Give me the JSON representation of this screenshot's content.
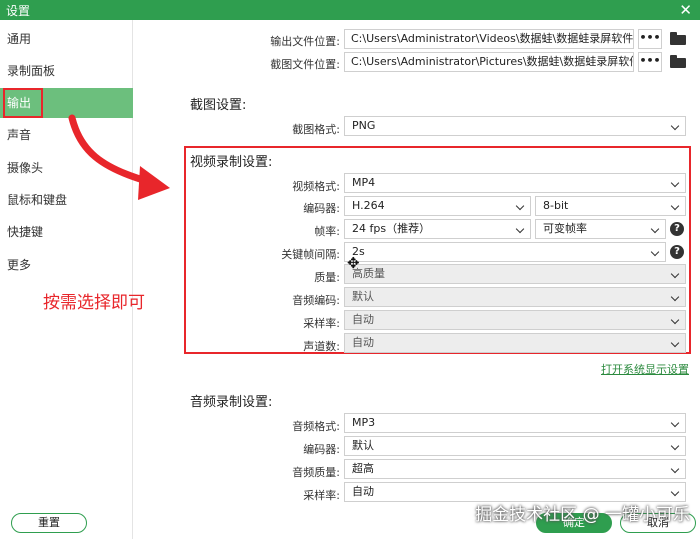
{
  "window": {
    "title": "设置",
    "close_glyph": "✕"
  },
  "sidebar": {
    "items": [
      {
        "label": "通用"
      },
      {
        "label": "录制面板"
      },
      {
        "label": "输出"
      },
      {
        "label": "声音"
      },
      {
        "label": "摄像头"
      },
      {
        "label": "鼠标和键盘"
      },
      {
        "label": "快捷键"
      },
      {
        "label": "更多"
      }
    ],
    "active_index": 2
  },
  "annotation": {
    "text": "按需选择即可",
    "color": "#e8262b"
  },
  "output": {
    "output_location_label": "输出文件位置:",
    "output_location_value": "C:\\Users\\Administrator\\Videos\\数据蛙\\数据蛙录屏软件",
    "screenshot_location_label": "截图文件位置:",
    "screenshot_location_value": "C:\\Users\\Administrator\\Pictures\\数据蛙\\数据蛙录屏软件",
    "browse_label": "•••"
  },
  "screenshot_settings": {
    "heading": "截图设置:",
    "format_label": "截图格式:",
    "format_value": "PNG"
  },
  "video_settings": {
    "heading": "视频录制设置:",
    "format_label": "视频格式:",
    "format_value": "MP4",
    "encoder_label": "编码器:",
    "encoder_value": "H.264",
    "bitdepth_value": "8-bit",
    "framerate_label": "帧率:",
    "framerate_value": "24 fps（推荐）",
    "framerate_mode_value": "可变帧率",
    "keyframe_label": "关键帧间隔:",
    "keyframe_value": "2s",
    "quality_label": "质量:",
    "quality_value": "高质量",
    "audio_codec_label": "音频编码:",
    "audio_codec_value": "默认",
    "samplerate_label": "采样率:",
    "samplerate_value": "自动",
    "channels_label": "声道数:",
    "channels_value": "自动",
    "help_glyph": "?"
  },
  "display_settings_link": "打开系统显示设置",
  "audio_settings": {
    "heading": "音频录制设置:",
    "format_label": "音频格式:",
    "format_value": "MP3",
    "encoder_label": "编码器:",
    "encoder_value": "默认",
    "quality_label": "音频质量:",
    "quality_value": "超高",
    "samplerate_label": "采样率:",
    "samplerate_value": "自动"
  },
  "footer": {
    "reset_label": "重置",
    "ok_label": "确定",
    "cancel_label": "取消"
  },
  "watermark": "掘金技术社区 @ 一罐小可乐",
  "colors": {
    "brand_green": "#2f9e4f",
    "sidebar_active": "#6cbf7d",
    "highlight_red": "#e8262b"
  }
}
